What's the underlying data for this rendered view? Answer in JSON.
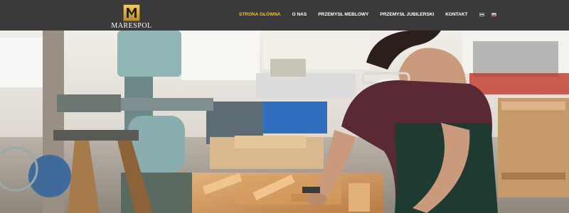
{
  "brand": {
    "name": "MARESPOL",
    "mark": "M"
  },
  "nav": {
    "items": [
      {
        "label": "STRONA GŁÓWNA",
        "active": true
      },
      {
        "label": "O NAS",
        "active": false
      },
      {
        "label": "PRZEMYSŁ MEBLOWY",
        "active": false
      },
      {
        "label": "PRZEMYSŁ JUBILERSKI",
        "active": false
      },
      {
        "label": "KONTAKT",
        "active": false
      }
    ],
    "languages": [
      {
        "code": "pl",
        "icon": "poland-flag-icon"
      },
      {
        "code": "pl",
        "icon": "poland-flag-icon"
      }
    ]
  },
  "colors": {
    "header_bg": "#3a3a3a",
    "nav_active": "#f2c233",
    "nav_text": "#ffffff",
    "logo_gold": "#d4a93c"
  },
  "hero": {
    "image": "woodworker-in-workshop-photo"
  }
}
